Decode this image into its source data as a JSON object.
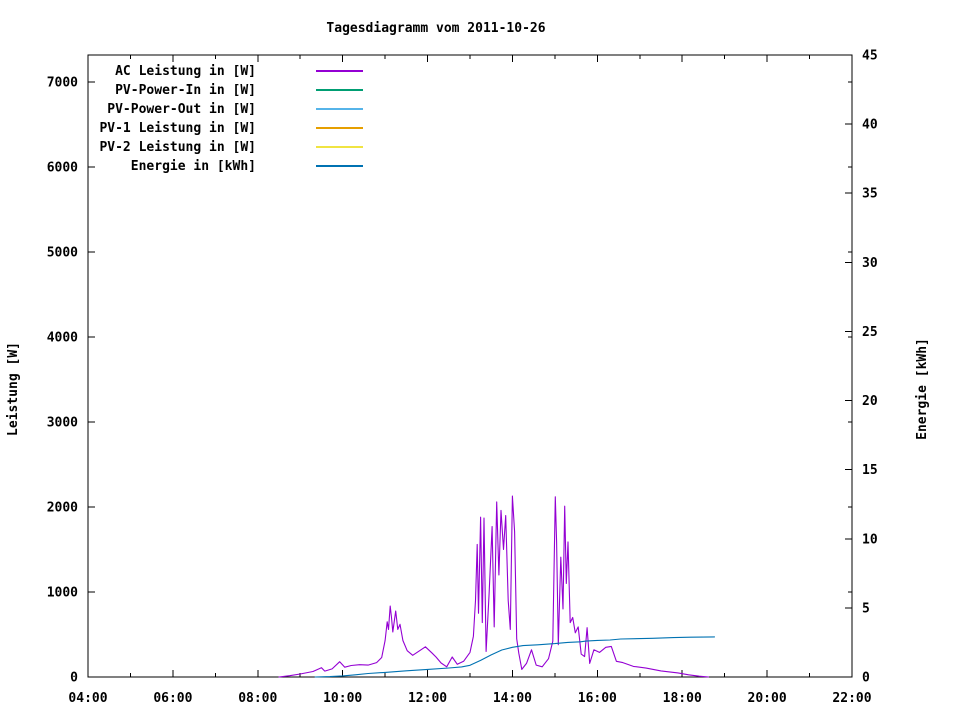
{
  "colors": {
    "background": "#ffffff",
    "text": "#000000",
    "frame": "#000000"
  },
  "chart_data": {
    "type": "line",
    "title": "Tagesdiagramm vom 2011-10-26",
    "grid": "off",
    "legend_position": "top-left-inside",
    "x_axis": {
      "range": [
        4,
        22
      ],
      "major_ticks": [
        {
          "t": 4,
          "label": "04:00"
        },
        {
          "t": 6,
          "label": "06:00"
        },
        {
          "t": 8,
          "label": "08:00"
        },
        {
          "t": 10,
          "label": "10:00"
        },
        {
          "t": 12,
          "label": "12:00"
        },
        {
          "t": 14,
          "label": "14:00"
        },
        {
          "t": 16,
          "label": "16:00"
        },
        {
          "t": 18,
          "label": "18:00"
        },
        {
          "t": 20,
          "label": "20:00"
        },
        {
          "t": 22,
          "label": "22:00"
        }
      ],
      "minor_ticks": [
        5,
        7,
        9,
        11,
        13,
        15,
        17,
        19,
        21
      ]
    },
    "y_left": {
      "label": "Leistung [W]",
      "range": [
        0,
        7318
      ],
      "ticks": [
        {
          "v": 0,
          "label": "0"
        },
        {
          "v": 1000,
          "label": "1000"
        },
        {
          "v": 2000,
          "label": "2000"
        },
        {
          "v": 3000,
          "label": "3000"
        },
        {
          "v": 4000,
          "label": "4000"
        },
        {
          "v": 5000,
          "label": "5000"
        },
        {
          "v": 6000,
          "label": "6000"
        },
        {
          "v": 7000,
          "label": "7000"
        }
      ]
    },
    "y_right": {
      "label": "Energie [kWh]",
      "range": [
        0,
        45
      ],
      "ticks": [
        {
          "v": 0,
          "label": "0"
        },
        {
          "v": 5,
          "label": "5"
        },
        {
          "v": 10,
          "label": "10"
        },
        {
          "v": 15,
          "label": "15"
        },
        {
          "v": 20,
          "label": "20"
        },
        {
          "v": 25,
          "label": "25"
        },
        {
          "v": 30,
          "label": "30"
        },
        {
          "v": 35,
          "label": "35"
        },
        {
          "v": 40,
          "label": "40"
        },
        {
          "v": 45,
          "label": "45"
        }
      ]
    },
    "series": [
      {
        "name": "AC Leistung in [W]",
        "color": "#9400D3",
        "axis": "left",
        "points": [
          [
            8.5,
            0
          ],
          [
            8.75,
            15
          ],
          [
            9.0,
            35
          ],
          [
            9.3,
            65
          ],
          [
            9.5,
            110
          ],
          [
            9.58,
            70
          ],
          [
            9.75,
            95
          ],
          [
            9.93,
            180
          ],
          [
            10.05,
            115
          ],
          [
            10.2,
            135
          ],
          [
            10.4,
            145
          ],
          [
            10.6,
            140
          ],
          [
            10.8,
            170
          ],
          [
            10.92,
            230
          ],
          [
            11.0,
            430
          ],
          [
            11.05,
            650
          ],
          [
            11.08,
            560
          ],
          [
            11.12,
            835
          ],
          [
            11.15,
            700
          ],
          [
            11.18,
            530
          ],
          [
            11.25,
            776
          ],
          [
            11.3,
            560
          ],
          [
            11.35,
            620
          ],
          [
            11.42,
            430
          ],
          [
            11.52,
            310
          ],
          [
            11.65,
            255
          ],
          [
            11.8,
            305
          ],
          [
            11.95,
            355
          ],
          [
            12.1,
            285
          ],
          [
            12.2,
            235
          ],
          [
            12.32,
            165
          ],
          [
            12.45,
            120
          ],
          [
            12.58,
            235
          ],
          [
            12.7,
            150
          ],
          [
            12.85,
            185
          ],
          [
            13.0,
            290
          ],
          [
            13.08,
            480
          ],
          [
            13.13,
            900
          ],
          [
            13.17,
            1560
          ],
          [
            13.2,
            750
          ],
          [
            13.25,
            1880
          ],
          [
            13.29,
            640
          ],
          [
            13.33,
            1870
          ],
          [
            13.38,
            300
          ],
          [
            13.45,
            980
          ],
          [
            13.52,
            1770
          ],
          [
            13.57,
            590
          ],
          [
            13.63,
            2060
          ],
          [
            13.68,
            1200
          ],
          [
            13.73,
            1960
          ],
          [
            13.79,
            1500
          ],
          [
            13.84,
            1900
          ],
          [
            13.9,
            900
          ],
          [
            13.95,
            560
          ],
          [
            14.0,
            2130
          ],
          [
            14.05,
            1710
          ],
          [
            14.1,
            450
          ],
          [
            14.15,
            280
          ],
          [
            14.22,
            90
          ],
          [
            14.33,
            160
          ],
          [
            14.45,
            320
          ],
          [
            14.56,
            140
          ],
          [
            14.7,
            120
          ],
          [
            14.85,
            215
          ],
          [
            14.95,
            420
          ],
          [
            15.01,
            2120
          ],
          [
            15.04,
            1590
          ],
          [
            15.08,
            380
          ],
          [
            15.14,
            1410
          ],
          [
            15.19,
            800
          ],
          [
            15.23,
            2010
          ],
          [
            15.27,
            1100
          ],
          [
            15.31,
            1590
          ],
          [
            15.36,
            640
          ],
          [
            15.42,
            700
          ],
          [
            15.48,
            520
          ],
          [
            15.55,
            590
          ],
          [
            15.62,
            270
          ],
          [
            15.7,
            240
          ],
          [
            15.76,
            580
          ],
          [
            15.82,
            160
          ],
          [
            15.92,
            320
          ],
          [
            16.05,
            290
          ],
          [
            16.2,
            350
          ],
          [
            16.33,
            360
          ],
          [
            16.45,
            185
          ],
          [
            16.6,
            170
          ],
          [
            16.85,
            125
          ],
          [
            17.15,
            105
          ],
          [
            17.5,
            72
          ],
          [
            17.9,
            48
          ],
          [
            18.15,
            26
          ],
          [
            18.4,
            10
          ],
          [
            18.62,
            0
          ]
        ]
      },
      {
        "name": "PV-Power-In in [W]",
        "color": "#009E73",
        "axis": "left",
        "points": []
      },
      {
        "name": "PV-Power-Out in [W]",
        "color": "#56B4E9",
        "axis": "left",
        "points": []
      },
      {
        "name": "PV-1 Leistung in [W]",
        "color": "#E69F00",
        "axis": "left",
        "points": []
      },
      {
        "name": "PV-2 Leistung in [W]",
        "color": "#F0E442",
        "axis": "left",
        "points": []
      },
      {
        "name": "Energie in [kWh]",
        "color": "#0072B2",
        "axis": "right",
        "points": [
          [
            9.35,
            0
          ],
          [
            9.7,
            0.03
          ],
          [
            10.0,
            0.08
          ],
          [
            10.3,
            0.16
          ],
          [
            10.6,
            0.25
          ],
          [
            11.0,
            0.33
          ],
          [
            11.5,
            0.45
          ],
          [
            12.0,
            0.55
          ],
          [
            12.5,
            0.65
          ],
          [
            12.8,
            0.73
          ],
          [
            13.0,
            0.85
          ],
          [
            13.25,
            1.2
          ],
          [
            13.5,
            1.6
          ],
          [
            13.75,
            1.95
          ],
          [
            14.0,
            2.15
          ],
          [
            14.25,
            2.27
          ],
          [
            14.6,
            2.33
          ],
          [
            15.0,
            2.42
          ],
          [
            15.3,
            2.5
          ],
          [
            15.6,
            2.55
          ],
          [
            15.73,
            2.6
          ],
          [
            16.0,
            2.65
          ],
          [
            16.3,
            2.68
          ],
          [
            16.55,
            2.75
          ],
          [
            17.3,
            2.8
          ],
          [
            17.8,
            2.85
          ],
          [
            18.2,
            2.88
          ],
          [
            18.76,
            2.9
          ]
        ]
      }
    ]
  }
}
